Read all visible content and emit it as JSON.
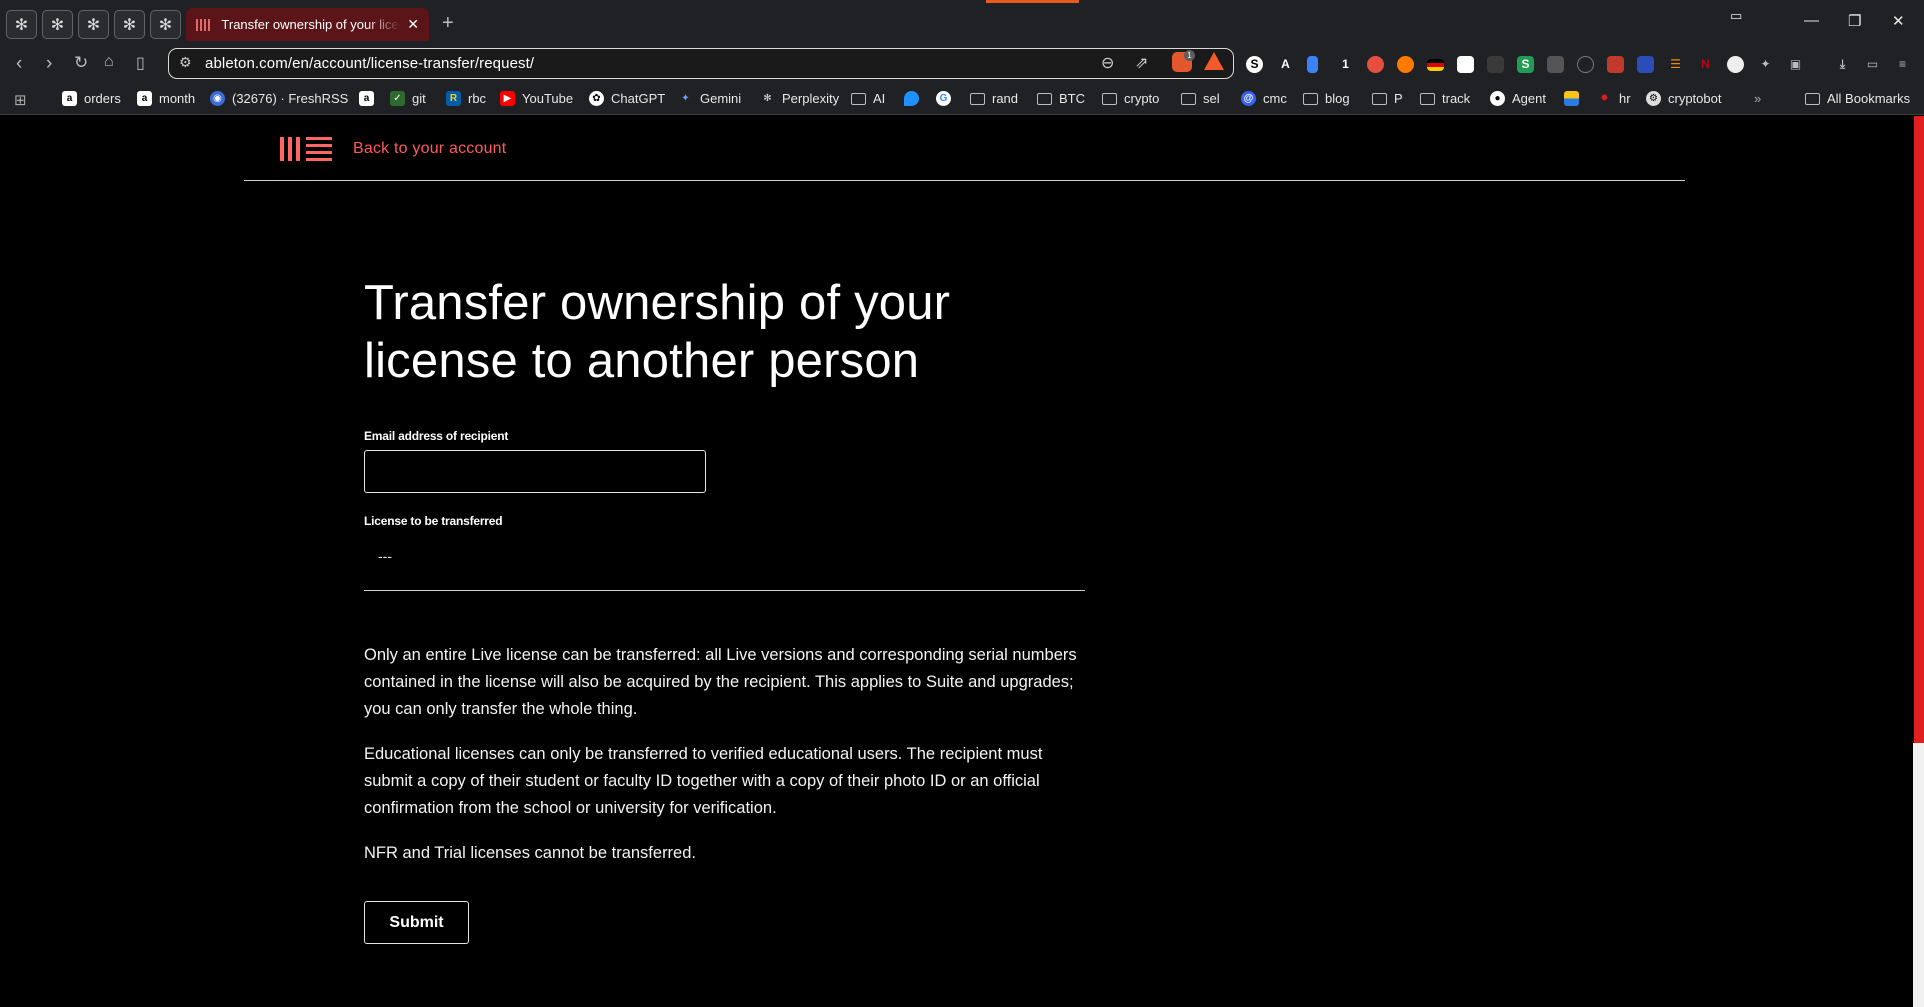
{
  "browser": {
    "active_tab_title": "Transfer ownership of your license to another person",
    "tab_close": "✕",
    "new_tab": "+",
    "url": "ableton.com/en/account/license-transfer/request/",
    "bookmarks": [
      {
        "label": "orders",
        "icon": "amazon-icon"
      },
      {
        "label": "month",
        "icon": "amazon-icon"
      },
      {
        "label": "(32676) · FreshRSS",
        "icon": "freshrss-icon"
      },
      {
        "label": "",
        "icon": "amazon-icon"
      },
      {
        "label": "git",
        "icon": "git-icon"
      },
      {
        "label": "rbc",
        "icon": "rbc-icon"
      },
      {
        "label": "YouTube",
        "icon": "youtube-icon"
      },
      {
        "label": "ChatGPT",
        "icon": "chatgpt-icon"
      },
      {
        "label": "Gemini",
        "icon": "gemini-icon"
      },
      {
        "label": "Perplexity",
        "icon": "perplexity-icon"
      },
      {
        "label": "AI",
        "icon": "folder-icon"
      },
      {
        "label": "",
        "icon": "drop-icon"
      },
      {
        "label": "",
        "icon": "google-icon"
      },
      {
        "label": "rand",
        "icon": "folder-icon"
      },
      {
        "label": "BTC",
        "icon": "folder-icon"
      },
      {
        "label": "crypto",
        "icon": "folder-icon"
      },
      {
        "label": "sel",
        "icon": "folder-icon"
      },
      {
        "label": "cmc",
        "icon": "cmc-icon"
      },
      {
        "label": "blog",
        "icon": "folder-icon"
      },
      {
        "label": "P",
        "icon": "folder-icon"
      },
      {
        "label": "track",
        "icon": "folder-icon"
      },
      {
        "label": "Agent",
        "icon": "agent-icon"
      },
      {
        "label": "",
        "icon": "flag-icon"
      },
      {
        "label": "hr",
        "icon": "maple-leaf-icon"
      },
      {
        "label": "cryptobot",
        "icon": "cryptobot-icon"
      }
    ],
    "all_bookmarks": "All Bookmarks",
    "more_bookmarks": "»"
  },
  "page": {
    "back_link": "Back to your account",
    "title": "Transfer ownership of your license to another person",
    "email_label": "Email address of recipient",
    "email_value": "",
    "license_label": "License to be transferred",
    "license_value": "---",
    "paragraphs": [
      "Only an entire Live license can be transferred: all Live versions and corresponding serial numbers contained in the license will also be acquired by the recipient. This applies to Suite and upgrades; you can only transfer the whole thing.",
      "Educational licenses can only be transferred to verified educational users. The recipient must submit a copy of their student or faculty ID together with a copy of their photo ID or an official confirmation from the school or university for verification.",
      "NFR and Trial licenses cannot be transferred."
    ],
    "submit_label": "Submit"
  },
  "colors": {
    "accent_red": "#ff5a5a",
    "background": "#000000",
    "chrome": "#202124"
  }
}
